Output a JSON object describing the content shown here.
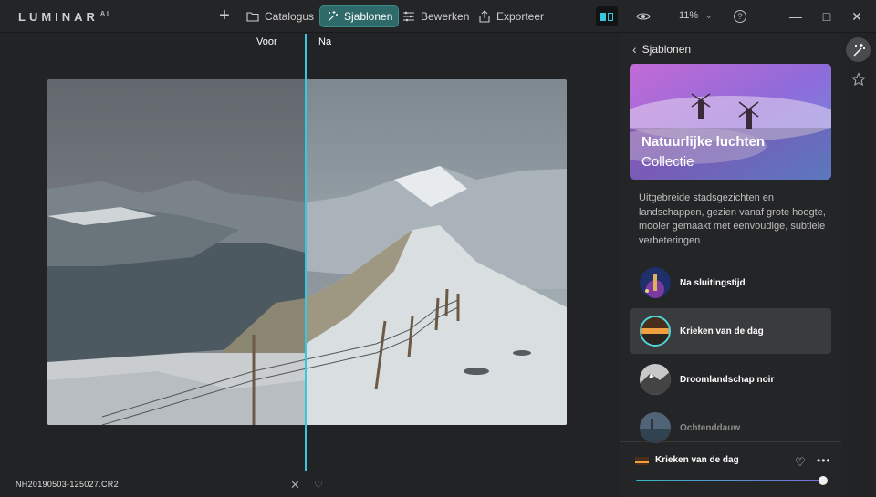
{
  "app": {
    "logo": "LUMINAR",
    "logo_suffix": "AI"
  },
  "toolbar": {
    "add_label": "+",
    "catalog_label": "Catalogus",
    "templates_label": "Sjablonen",
    "edit_label": "Bewerken",
    "export_label": "Exporteer",
    "zoom_value": "11%",
    "help_label": "?"
  },
  "window": {
    "minimize": "—",
    "maximize": "□",
    "close": "✕"
  },
  "compare": {
    "before_label": "Voor",
    "after_label": "Na"
  },
  "bottom": {
    "filename": "NH20190503-125027.CR2",
    "reject": "✕",
    "favorite": "♡"
  },
  "panel": {
    "back_label": "Sjablonen",
    "hero_title": "Natuurlijke luchten",
    "hero_subtitle": "Collectie",
    "description": "Uitgebreide stadsgezichten en landschappen, gezien vanaf grote hoogte, mooier gemaakt met eenvoudige, subtiele verbeteringen",
    "templates": [
      {
        "label": "Na sluitingstijd",
        "state": "normal"
      },
      {
        "label": "Krieken van de dag",
        "state": "active"
      },
      {
        "label": "Droomlandschap noir",
        "state": "normal"
      },
      {
        "label": "Ochtenddauw",
        "state": "faded"
      }
    ],
    "selected_label": "Krieken van de dag",
    "selected_more": "•••",
    "selected_heart": "♡",
    "amount": 1.0
  },
  "colors": {
    "accent": "#37c8df",
    "active_nav": "#2f6a6a"
  }
}
